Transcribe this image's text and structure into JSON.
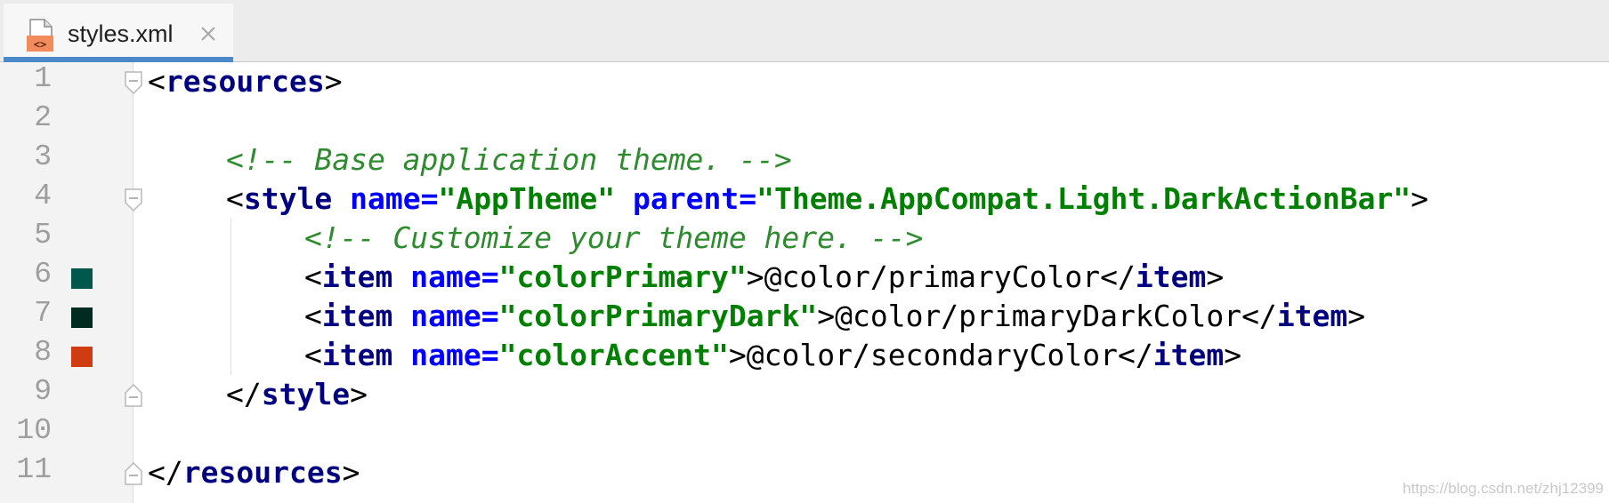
{
  "tab": {
    "filename": "styles.xml"
  },
  "gutter": {
    "line_numbers": [
      "1",
      "2",
      "3",
      "4",
      "5",
      "6",
      "7",
      "8",
      "9",
      "10",
      "11"
    ],
    "swatches": [
      {
        "line": 6,
        "color": "#00574b",
        "name": "colorPrimary"
      },
      {
        "line": 7,
        "color": "#002b20",
        "name": "colorPrimaryDark"
      },
      {
        "line": 8,
        "color": "#d03b12",
        "name": "colorAccent"
      }
    ]
  },
  "code": {
    "line1": {
      "lt": "<",
      "tag": "resources",
      "gt": ">"
    },
    "line3": {
      "comment": "<!-- Base application theme. -->"
    },
    "line4": {
      "lt": "<",
      "tag": "style",
      "attr1": "name",
      "eq1": "=",
      "val1": "\"AppTheme\"",
      "attr2": "parent",
      "eq2": "=",
      "val2": "\"Theme.AppCompat.Light.DarkActionBar\"",
      "gt": ">"
    },
    "line5": {
      "comment": "<!-- Customize your theme here. -->"
    },
    "line6": {
      "lt": "<",
      "tag": "item",
      "attr": "name",
      "eq": "=",
      "val": "\"colorPrimary\"",
      "gt": ">",
      "content": "@color/primaryColor",
      "close_lt": "</",
      "close_tag": "item",
      "close_gt": ">"
    },
    "line7": {
      "lt": "<",
      "tag": "item",
      "attr": "name",
      "eq": "=",
      "val": "\"colorPrimaryDark\"",
      "gt": ">",
      "content": "@color/primaryDarkColor",
      "close_lt": "</",
      "close_tag": "item",
      "close_gt": ">"
    },
    "line8": {
      "lt": "<",
      "tag": "item",
      "attr": "name",
      "eq": "=",
      "val": "\"colorAccent\"",
      "gt": ">",
      "content": "@color/secondaryColor",
      "close_lt": "</",
      "close_tag": "item",
      "close_gt": ">"
    },
    "line9": {
      "lt": "</",
      "tag": "style",
      "gt": ">"
    },
    "line11": {
      "lt": "</",
      "tag": "resources",
      "gt": ">"
    }
  },
  "watermark": "https://blog.csdn.net/zhj12399"
}
